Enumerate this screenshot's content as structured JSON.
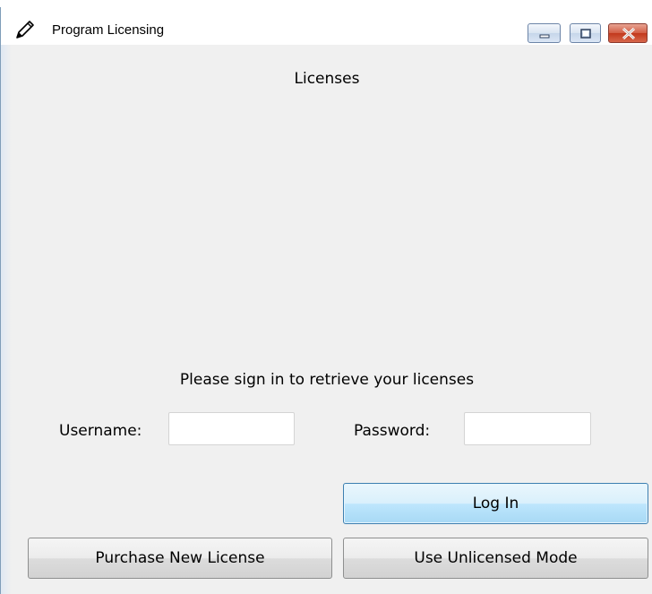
{
  "window": {
    "title": "Program Licensing",
    "app_icon": "pen-icon",
    "controls": [
      "minimize-icon",
      "maximize-icon",
      "close-icon"
    ]
  },
  "main": {
    "heading": "Licenses",
    "prompt": "Please sign in to retrieve your licenses"
  },
  "form": {
    "username_label": "Username:",
    "username_value": "",
    "password_label": "Password:",
    "password_value": ""
  },
  "buttons": {
    "login": "Log In",
    "purchase": "Purchase New License",
    "unlicensed": "Use Unlicensed Mode"
  },
  "colors": {
    "window_bg": "#f0f0f0",
    "login_button_accent": "#3c7fb1",
    "close_button": "#c2391d"
  }
}
